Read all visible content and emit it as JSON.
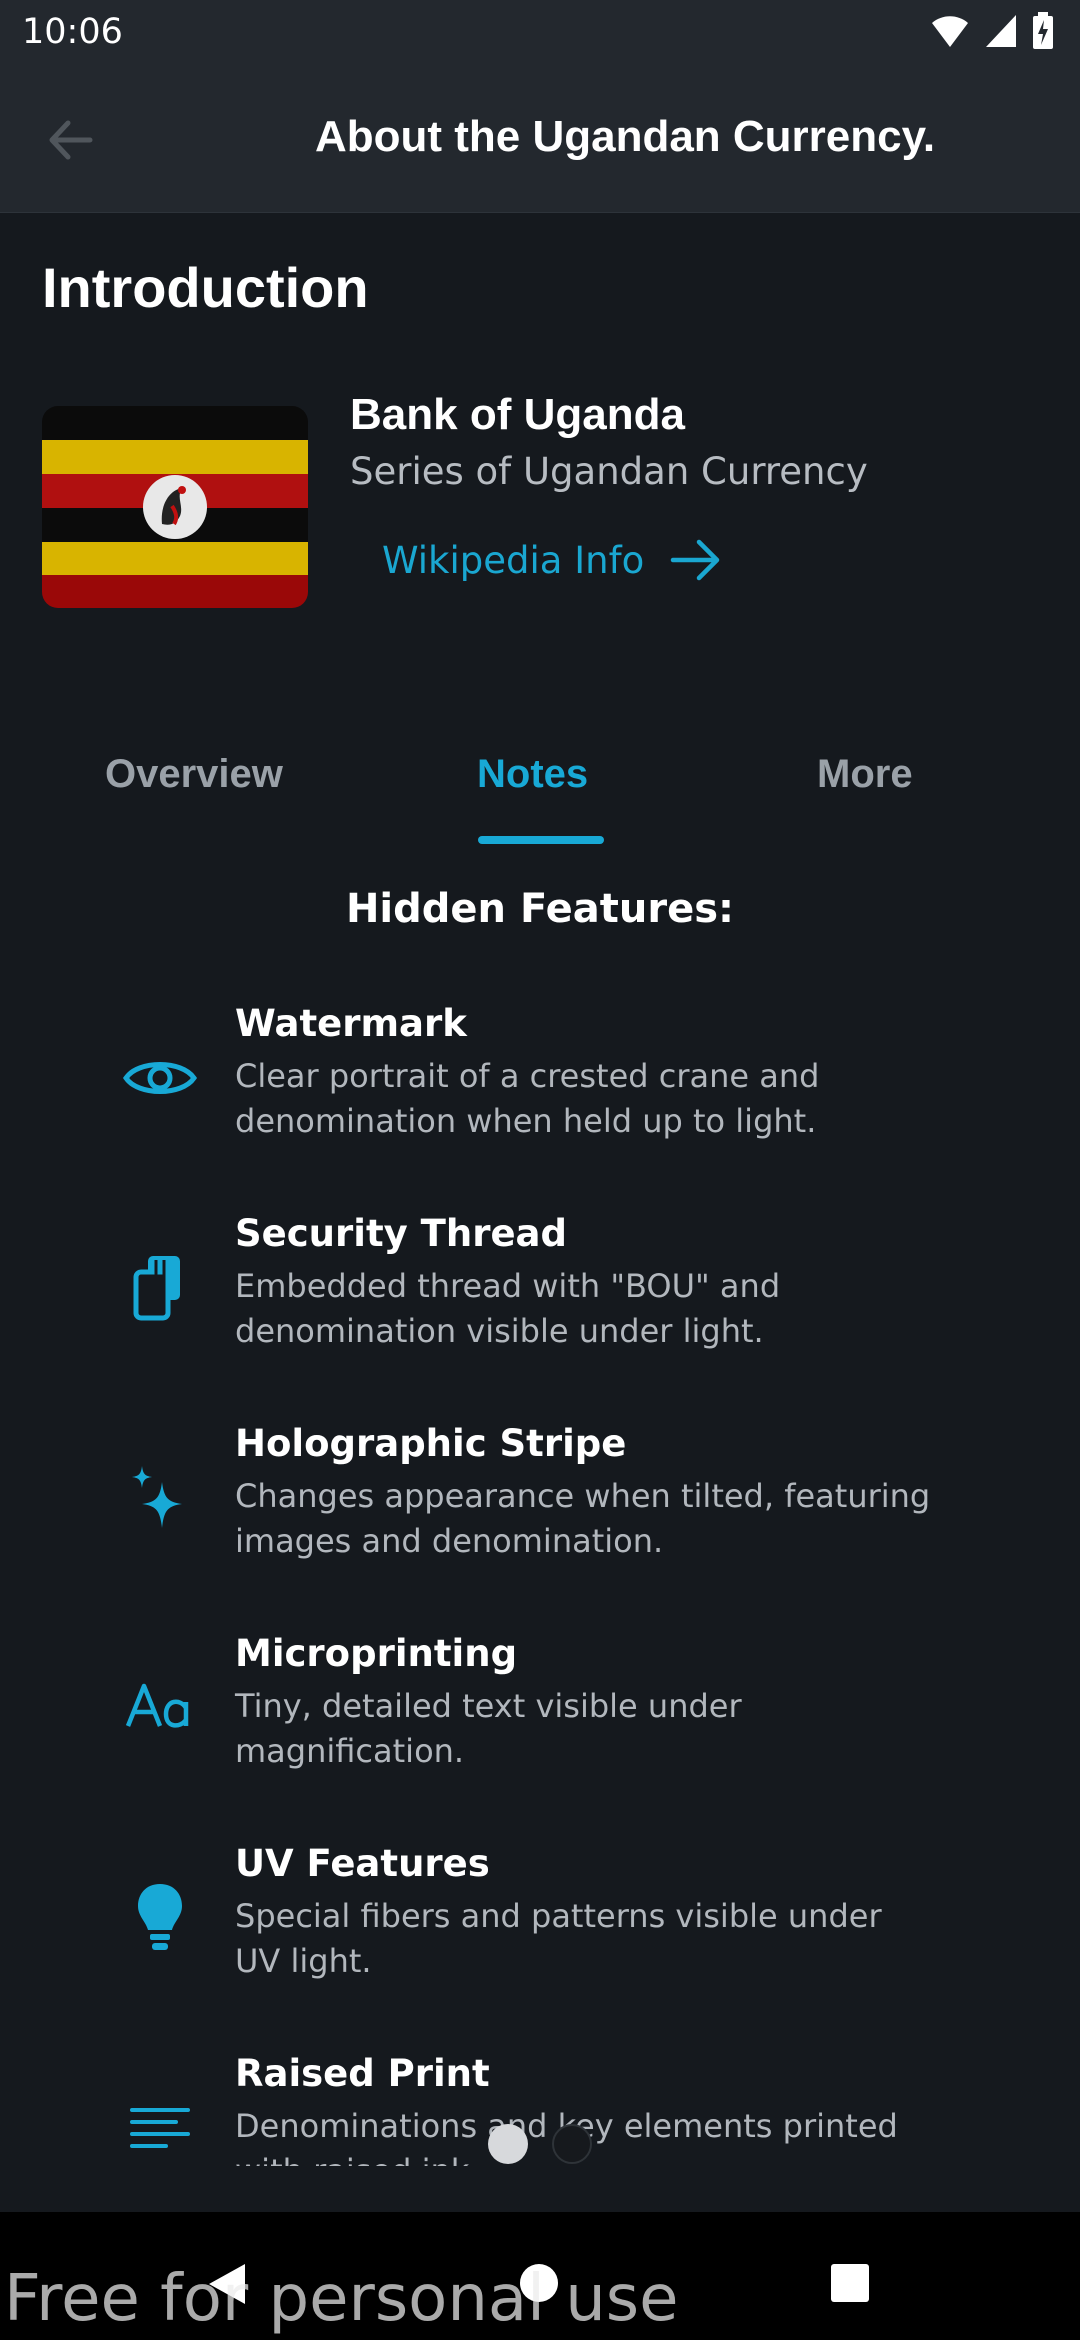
{
  "status_bar": {
    "time": "10:06",
    "icons": [
      "wifi-icon",
      "signal-icon",
      "battery-charging-icon"
    ]
  },
  "app_bar": {
    "back_icon": "arrow-left-icon",
    "title": "About the Ugandan Currency."
  },
  "intro": {
    "section_title": "Introduction",
    "bank_name": "Bank of Uganda",
    "subtitle": "Series of Ugandan Currency",
    "link_label": "Wikipedia Info",
    "link_icon": "arrow-right-icon"
  },
  "tabs": [
    {
      "label": "Overview",
      "selected": false
    },
    {
      "label": "Notes",
      "selected": true
    },
    {
      "label": "More",
      "selected": false
    }
  ],
  "features_heading": "Hidden Features:",
  "features": [
    {
      "icon": "eye-icon",
      "title": "Watermark",
      "desc": "Clear portrait of a crested crane and denomination when held up to light."
    },
    {
      "icon": "copy-document-icon",
      "title": "Security Thread",
      "desc": "Embedded thread with \"BOU\" and denomination visible under light."
    },
    {
      "icon": "sparkle-icon",
      "title": "Holographic Stripe",
      "desc": "Changes appearance when tilted, featuring images and denomination."
    },
    {
      "icon": "font-aa-icon",
      "title": "Microprinting",
      "desc": "Tiny, detailed text visible under magnification."
    },
    {
      "icon": "lightbulb-icon",
      "title": "UV Features",
      "desc": "Special fibers and patterns visible under UV light."
    },
    {
      "icon": "text-lines-icon",
      "title": "Raised Print",
      "desc": "Denominations and key elements printed with raised ink."
    }
  ],
  "pager": {
    "count": 2,
    "active_index": 0
  },
  "colors": {
    "accent": "#18a9d6",
    "background": "#15191e",
    "app_bar": "#23282e"
  },
  "watermark": "Free for personal use",
  "system_nav": [
    "back-triangle-icon",
    "home-circle-icon",
    "recents-square-icon"
  ]
}
